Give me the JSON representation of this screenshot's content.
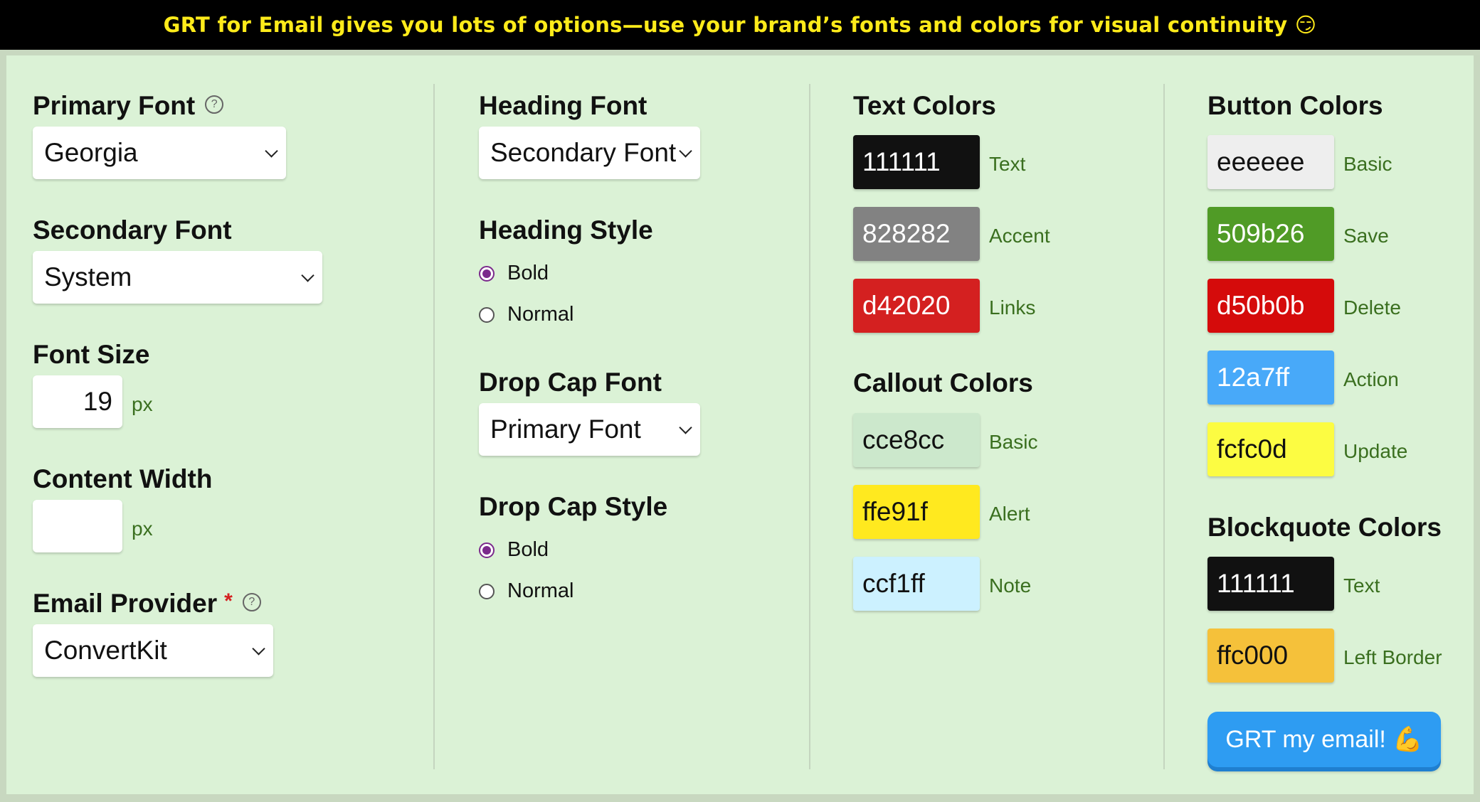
{
  "banner": {
    "text": "GRT for Email gives you lots of options—use your brand’s fonts and colors for visual continuity 😏"
  },
  "col1": {
    "primary_font": {
      "label": "Primary Font",
      "help": "?",
      "value": "Georgia"
    },
    "secondary_font": {
      "label": "Secondary Font",
      "value": "System"
    },
    "font_size": {
      "label": "Font Size",
      "value": "19",
      "unit": "px"
    },
    "content_width": {
      "label": "Content Width",
      "value": "",
      "unit": "px"
    },
    "email_provider": {
      "label": "Email Provider",
      "required": "*",
      "help": "?",
      "value": "ConvertKit"
    }
  },
  "col2": {
    "heading_font": {
      "label": "Heading Font",
      "value": "Secondary Font"
    },
    "heading_style": {
      "label": "Heading Style",
      "options": [
        "Bold",
        "Normal"
      ],
      "selected": "Bold"
    },
    "drop_cap_font": {
      "label": "Drop Cap Font",
      "value": "Primary Font"
    },
    "drop_cap_style": {
      "label": "Drop Cap Style",
      "options": [
        "Bold",
        "Normal"
      ],
      "selected": "Bold"
    }
  },
  "col3": {
    "text_colors": {
      "title": "Text Colors",
      "items": [
        {
          "hex": "111111",
          "label": "Text",
          "bg": "#111111",
          "fg": "#ffffff"
        },
        {
          "hex": "828282",
          "label": "Accent",
          "bg": "#828282",
          "fg": "#ffffff"
        },
        {
          "hex": "d42020",
          "label": "Links",
          "bg": "#d42020",
          "fg": "#ffffff"
        }
      ]
    },
    "callout_colors": {
      "title": "Callout Colors",
      "items": [
        {
          "hex": "cce8cc",
          "label": "Basic",
          "bg": "#cce8cc",
          "fg": "#111111"
        },
        {
          "hex": "ffe91f",
          "label": "Alert",
          "bg": "#ffe91f",
          "fg": "#111111"
        },
        {
          "hex": "ccf1ff",
          "label": "Note",
          "bg": "#ccf1ff",
          "fg": "#111111"
        }
      ]
    }
  },
  "col4": {
    "button_colors": {
      "title": "Button Colors",
      "items": [
        {
          "hex": "eeeeee",
          "label": "Basic",
          "bg": "#eeeeee",
          "fg": "#111111"
        },
        {
          "hex": "509b26",
          "label": "Save",
          "bg": "#509b26",
          "fg": "#ffffff"
        },
        {
          "hex": "d50b0b",
          "label": "Delete",
          "bg": "#d50b0b",
          "fg": "#ffffff"
        },
        {
          "hex": "12a7ff",
          "label": "Action",
          "bg": "#48a9f9",
          "fg": "#ffffff"
        },
        {
          "hex": "fcfc0d",
          "label": "Update",
          "bg": "#fcfc42",
          "fg": "#111111"
        }
      ]
    },
    "blockquote_colors": {
      "title": "Blockquote Colors",
      "items": [
        {
          "hex": "111111",
          "label": "Text",
          "bg": "#111111",
          "fg": "#ffffff"
        },
        {
          "hex": "ffc000",
          "label": "Left Border",
          "bg": "#f5c13a",
          "fg": "#111111"
        }
      ]
    },
    "cta": {
      "label": "GRT my email! 💪"
    }
  }
}
